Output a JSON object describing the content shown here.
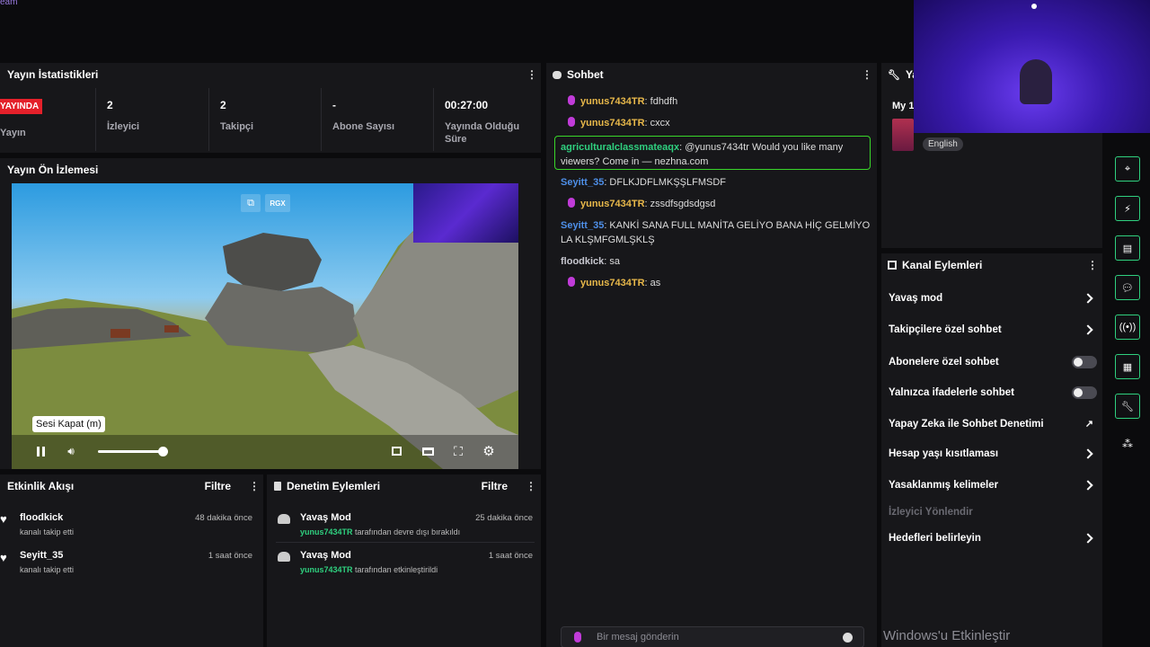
{
  "top": {
    "corner_text": "eam"
  },
  "stats_panel": {
    "title": "Yayın İstatistikleri",
    "live_badge": "YAYINDA",
    "live_label": "Yayın",
    "items": [
      {
        "value": "2",
        "label": "İzleyici"
      },
      {
        "value": "2",
        "label": "Takipçi"
      },
      {
        "value": "-",
        "label": "Abone Sayısı"
      },
      {
        "value": "00:27:00",
        "label": "Yayında Olduğu Süre"
      }
    ]
  },
  "preview_panel": {
    "title": "Yayın Ön İzlemesi",
    "overlay_badge": "RGX",
    "tooltip": "Sesi Kapat (m)",
    "volume_level": 0.98
  },
  "activity_panel": {
    "title": "Etkinlik Akışı",
    "filter_label": "Filtre",
    "items": [
      {
        "name": "floodkick",
        "sub": "kanalı takip etti",
        "time": "48 dakika önce"
      },
      {
        "name": "Seyitt_35",
        "sub": "kanalı takip etti",
        "time": "1 saat önce"
      }
    ]
  },
  "moderation_panel": {
    "title": "Denetim Eylemleri",
    "filter_label": "Filtre",
    "items": [
      {
        "title": "Yavaş Mod",
        "user": "yunus7434TR",
        "sub": "tarafından devre dışı bırakıldı",
        "time": "25 dakika önce"
      },
      {
        "title": "Yavaş Mod",
        "user": "yunus7434TR",
        "sub": "tarafından etkinleştirildi",
        "time": "1 saat önce"
      }
    ]
  },
  "chat_panel": {
    "title": "Sohbet",
    "messages": [
      {
        "user": "yunus7434TR",
        "text": ": fdhdfh"
      },
      {
        "user": "yunus7434TR",
        "text": ": cxcx"
      },
      {
        "user": "agriculturalclassmateaqx",
        "text": ": @yunus7434tr Would you like many viewers? Come in — nezhna.com"
      },
      {
        "user": "Seyitt_35",
        "text": ": DFLKJDFLMKŞŞLFMSDF"
      },
      {
        "user": "yunus7434TR",
        "text": ": zssdfsgdsdgsd"
      },
      {
        "user": "Seyitt_35",
        "text": ": KANKİ SANA FULL MANİTA GELİYO BANA HİÇ GELMİYO LA KLŞMFGMLŞKLŞ"
      },
      {
        "user": "floodkick",
        "text": ": sa"
      },
      {
        "user": "yunus7434TR",
        "text": ": as"
      }
    ],
    "input_placeholder": "Bir mesaj gönderin"
  },
  "tools_panel": {
    "title_partial": "Ya",
    "my_label": "My 1",
    "language_tag": "English"
  },
  "channel_actions": {
    "title": "Kanal Eylemleri",
    "items": [
      {
        "label": "Yavaş mod",
        "control": "chevron"
      },
      {
        "label": "Takipçilere özel sohbet",
        "control": "chevron"
      },
      {
        "label": "Abonelere özel sohbet",
        "control": "toggle"
      },
      {
        "label": "Yalnızca ifadelerle sohbet",
        "control": "toggle"
      },
      {
        "label": "Yapay Zeka ile Sohbet Denetimi",
        "control": "external"
      },
      {
        "label": "Hesap yaşı kısıtlaması",
        "control": "chevron"
      },
      {
        "label": "Yasaklanmış kelimeler",
        "control": "chevron"
      },
      {
        "label": "İzleyici Yönlendir",
        "control": "none"
      },
      {
        "label": "Hedefleri belirleyin",
        "control": "chevron"
      }
    ]
  },
  "watermark": "Windows'u Etkinleştir",
  "colors": {
    "accent": "#2fd07f",
    "live": "#e4202a",
    "mic": "#c03bd8"
  }
}
